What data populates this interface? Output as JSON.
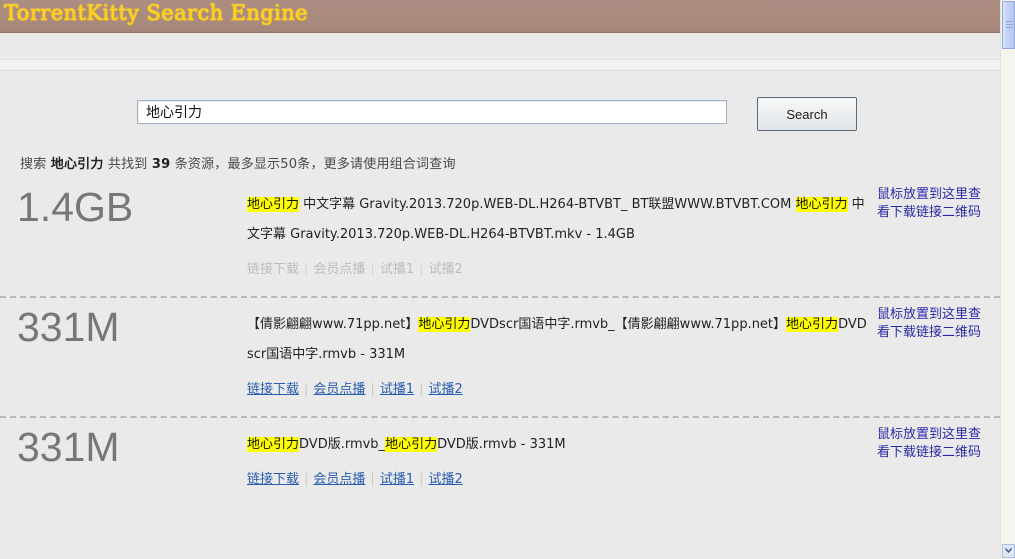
{
  "header": {
    "title": "TorrentKitty Search Engine",
    "bg_color": "#a98b80",
    "title_color": "#ffd21e"
  },
  "search": {
    "value": "地心引力",
    "placeholder": "",
    "button_label": "Search"
  },
  "summary": {
    "prefix": "搜索",
    "keyword": "地心引力",
    "middle": "共找到",
    "count": "39",
    "suffix": "条资源，最多显示50条，更多请使用组合词查询"
  },
  "qr_hint": "鼠标放置到这里查看下载链接二维码",
  "link_labels": {
    "download": "链接下载",
    "vip": "会员点播",
    "preview1": "试播1",
    "preview2": "试播2",
    "separator": "|"
  },
  "colors": {
    "highlight": "#ffff00",
    "link_active": "#2a5db0",
    "link_muted": "#bdbdbd",
    "size_text": "#777777",
    "qr_text": "#2b2ba8",
    "page_bg": "#eaeaea"
  },
  "results": [
    {
      "size": "1.4GB",
      "title_html": "<span class=\"hl\">地心引力</span> 中文字幕 Gravity.2013.720p.WEB-DL.H264-BTVBT_ BT联盟WWW.BTVBT.COM <span class=\"hl\">地心引力</span> 中文字幕 Gravity.2013.720p.WEB-DL.H264-BTVBT.mkv - 1.4GB",
      "title_text": "地心引力 中文字幕 Gravity.2013.720p.WEB-DL.H264-BTVBT_ BT联盟WWW.BTVBT.COM 地心引力 中文字幕 Gravity.2013.720p.WEB-DL.H264-BTVBT.mkv - 1.4GB",
      "links_state": "muted"
    },
    {
      "size": "331M",
      "title_html": "【倩影翩翩www.71pp.net】<span class=\"hl\">地心引力</span>DVDscr国语中字.rmvb_【倩影翩翩www.71pp.net】<span class=\"hl\">地心引力</span>DVDscr国语中字.rmvb - 331M",
      "title_text": "【倩影翩翩www.71pp.net】地心引力DVDscr国语中字.rmvb_【倩影翩翩www.71pp.net】地心引力DVDscr国语中字.rmvb - 331M",
      "links_state": "active"
    },
    {
      "size": "331M",
      "title_html": "<span class=\"hl\">地心引力</span>DVD版.rmvb_<span class=\"hl\">地心引力</span>DVD版.rmvb - 331M",
      "title_text": "地心引力DVD版.rmvb_地心引力DVD版.rmvb - 331M",
      "links_state": "active"
    }
  ],
  "scrollbar": {
    "thumb_top_pct": 0,
    "arrow_glyph": "▼"
  }
}
